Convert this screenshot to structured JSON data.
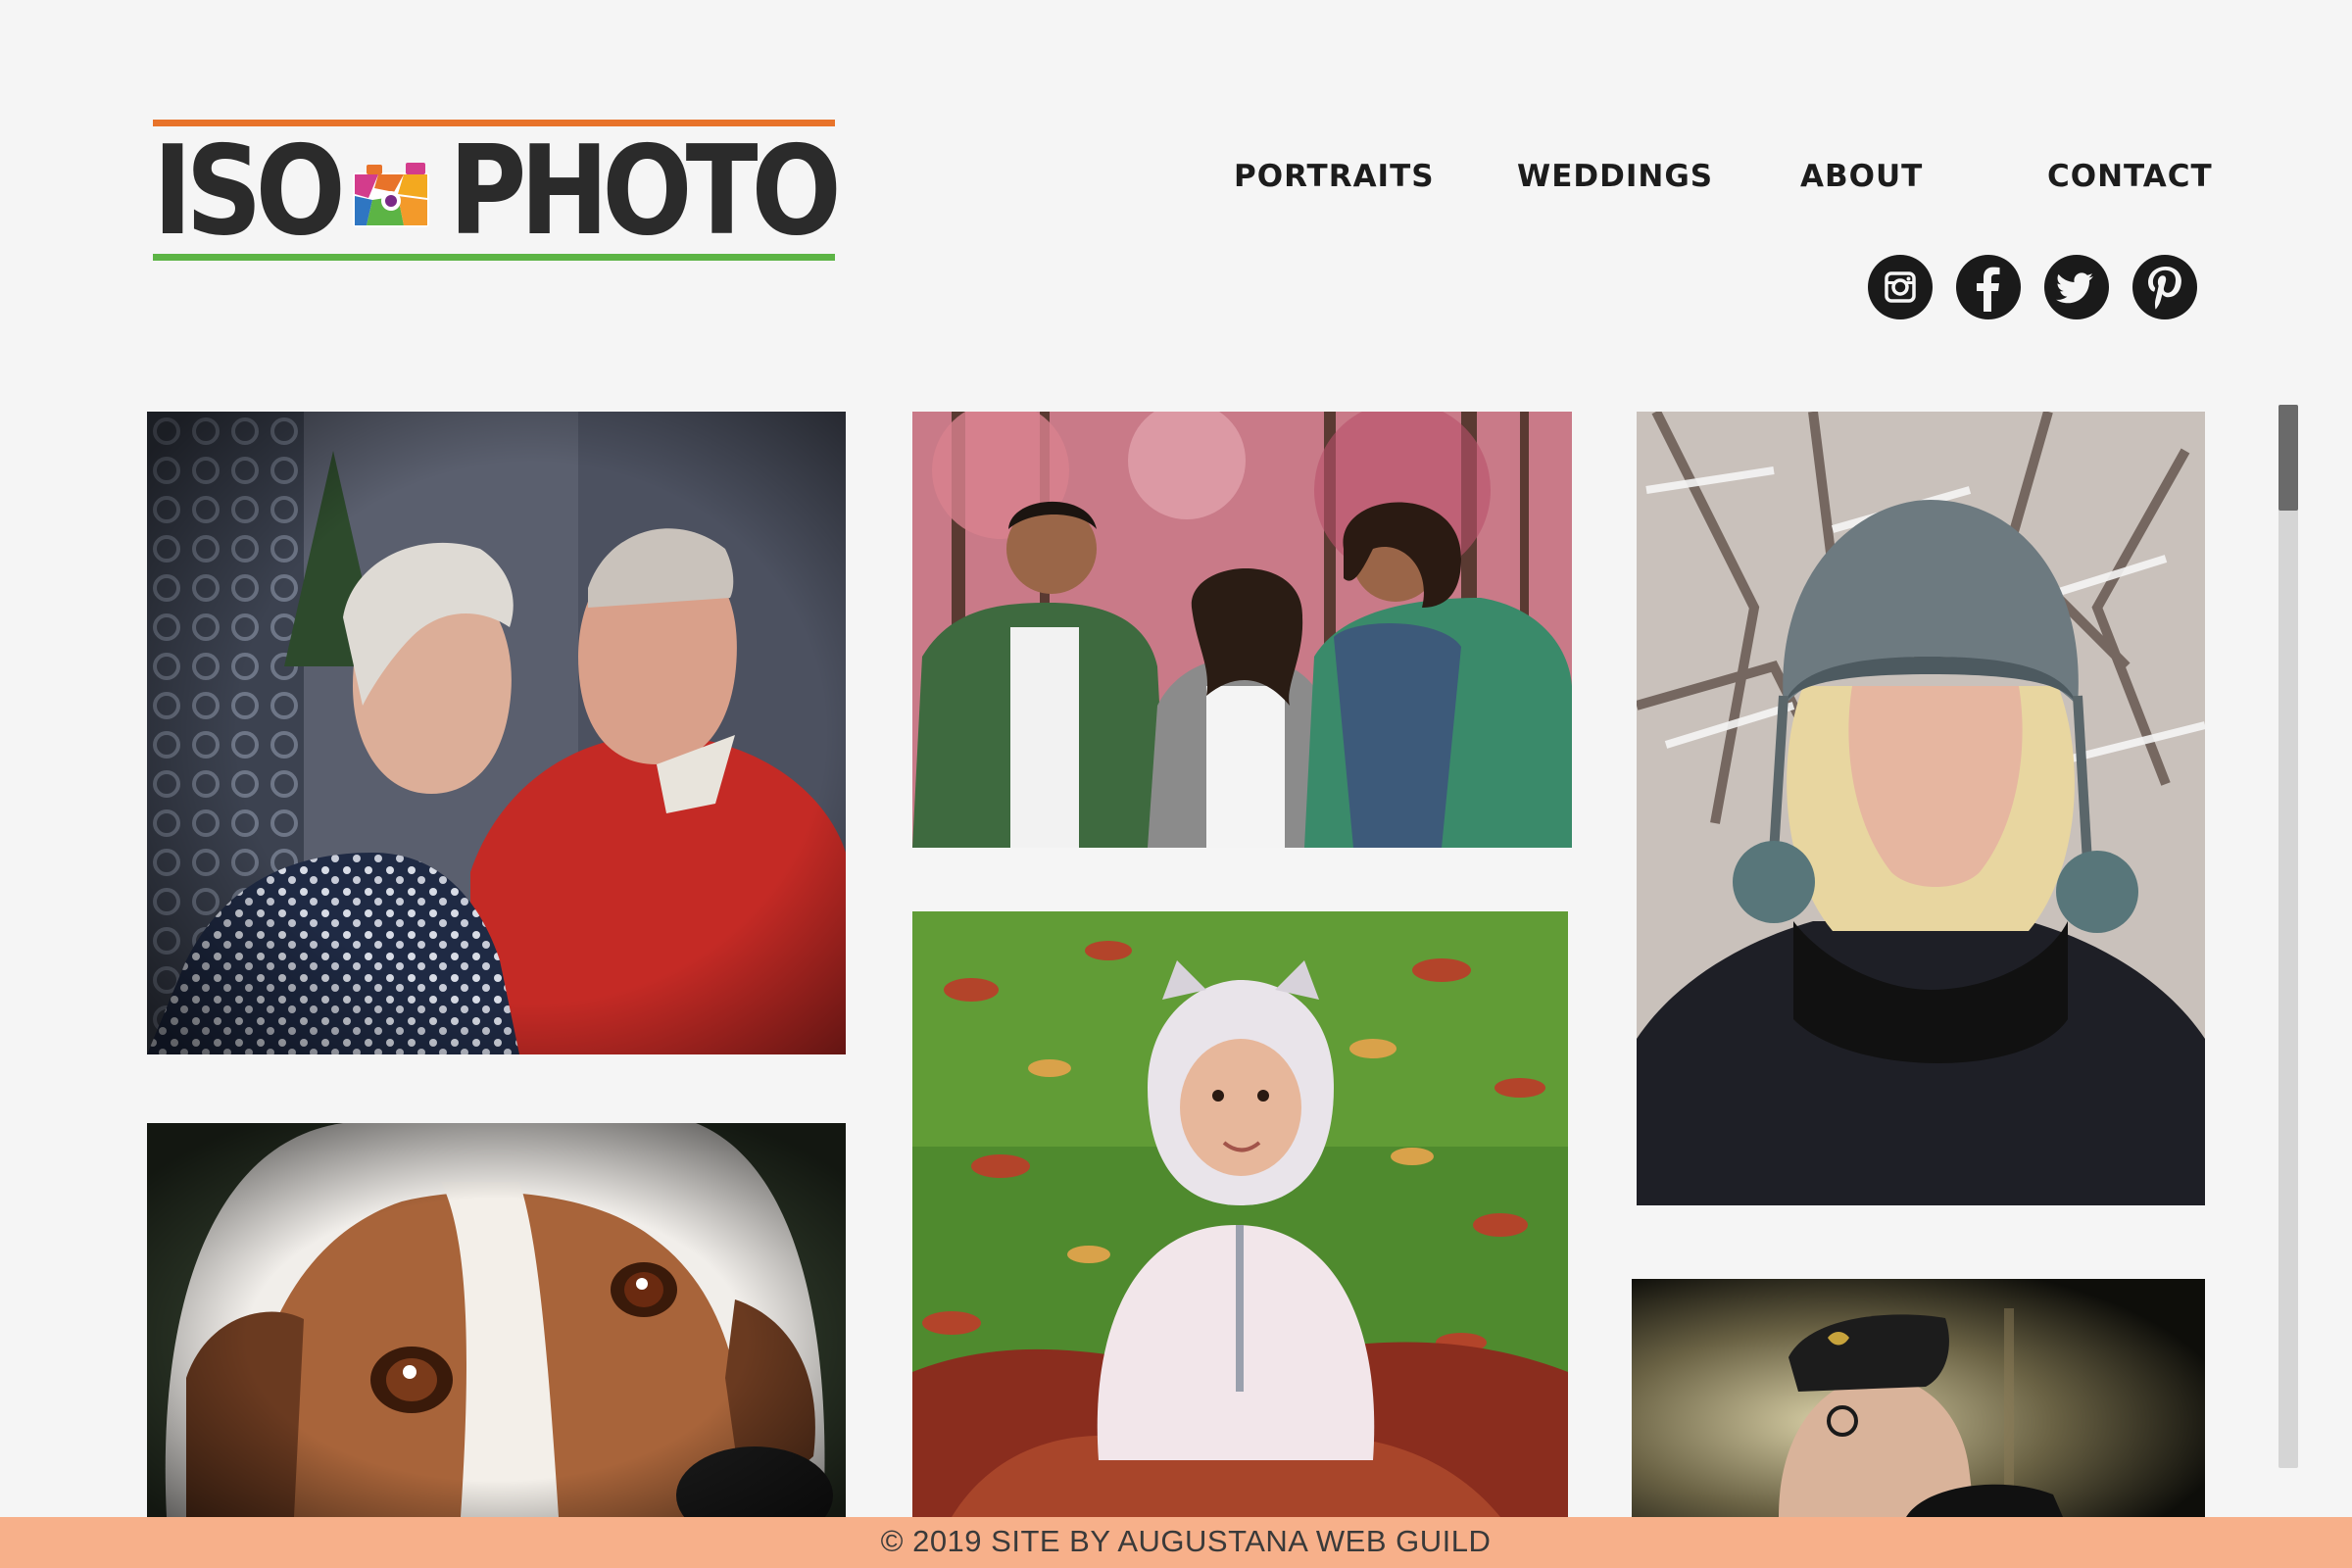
{
  "brand": {
    "name_left": "ISO",
    "name_right": "PHOTO",
    "colors": {
      "top_line": "#e8732a",
      "bottom_line": "#5cb445",
      "text": "#2b2b2b"
    }
  },
  "nav": {
    "items": [
      {
        "label": "PORTRAITS"
      },
      {
        "label": "WEDDINGS"
      },
      {
        "label": "ABOUT"
      },
      {
        "label": "CONTACT"
      }
    ]
  },
  "social": {
    "icons": [
      "instagram-icon",
      "facebook-icon",
      "twitter-icon",
      "pinterest-icon"
    ]
  },
  "gallery": {
    "photos": [
      "couple-kissing-photo",
      "siblings-autumn-photo",
      "woman-winter-hat-photo",
      "baby-autumn-leaves-photo",
      "beagle-closeup-photo",
      "veteran-portrait-photo"
    ]
  },
  "scrollbar": {
    "position": 0.0
  },
  "footer": {
    "text": "© 2019 SITE BY AUGUSTANA WEB GUILD",
    "background": "#f7b08a"
  }
}
